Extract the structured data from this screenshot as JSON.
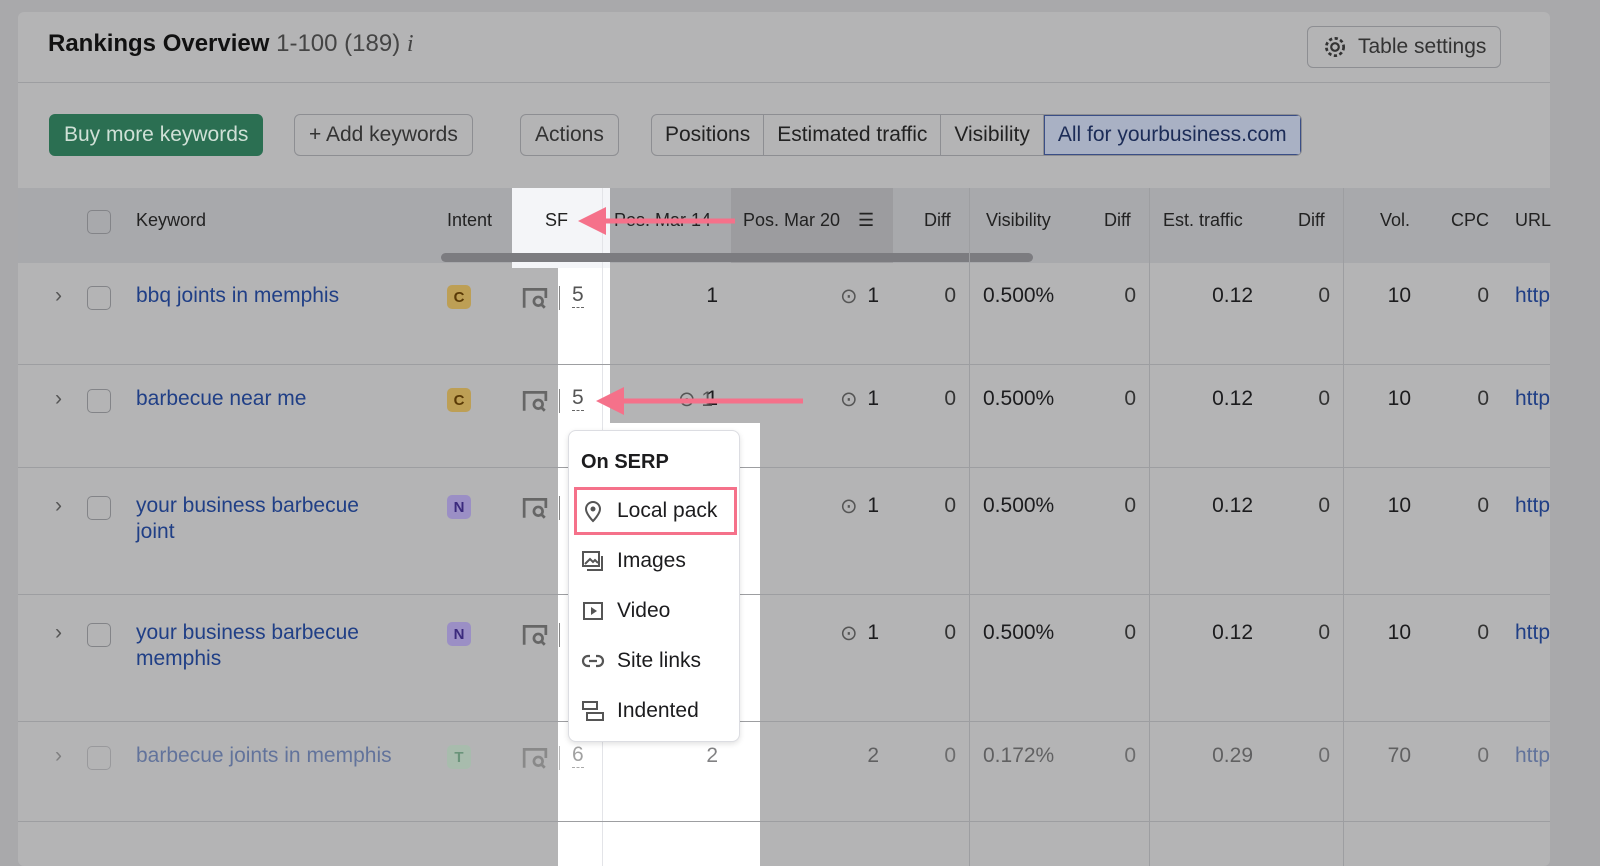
{
  "header": {
    "title": "Rankings Overview",
    "range": "1-100 (189)",
    "info_icon": "info-icon",
    "table_settings": "Table settings"
  },
  "toolbar": {
    "buy": "Buy more keywords",
    "add": "+ Add keywords",
    "actions": "Actions",
    "tabs": [
      {
        "label": "Positions"
      },
      {
        "label": "Estimated traffic"
      },
      {
        "label": "Visibility"
      },
      {
        "label": "All for yourbusiness.com",
        "active": true
      }
    ]
  },
  "columns": [
    "Keyword",
    "Intent",
    "SF",
    "Pos. Mar 14",
    "Pos. Mar 20",
    "Diff",
    "Visibility",
    "Diff",
    "Est. traffic",
    "Diff",
    "Vol.",
    "CPC",
    "URL"
  ],
  "rows": [
    {
      "keyword": "bbq joints in memphis",
      "intent": "C",
      "sf": "5",
      "pos14": "1",
      "pos20": "1",
      "diff": "0",
      "visibility": "0.500%",
      "vdiff": "0",
      "traffic": "0.12",
      "tdiff": "0",
      "vol": "10",
      "cpc": "0",
      "url": "http"
    },
    {
      "keyword": "barbecue near me",
      "intent": "C",
      "sf": "5",
      "pos14": "1",
      "pos20": "1",
      "diff": "0",
      "visibility": "0.500%",
      "vdiff": "0",
      "traffic": "0.12",
      "tdiff": "0",
      "vol": "10",
      "cpc": "0",
      "url": "http"
    },
    {
      "keyword": "your business barbecue joint",
      "intent": "N",
      "sf": "",
      "pos14": "",
      "pos20": "1",
      "diff": "0",
      "visibility": "0.500%",
      "vdiff": "0",
      "traffic": "0.12",
      "tdiff": "0",
      "vol": "10",
      "cpc": "0",
      "url": "http"
    },
    {
      "keyword": "your business barbecue memphis",
      "intent": "N",
      "sf": "",
      "pos14": "",
      "pos20": "1",
      "diff": "0",
      "visibility": "0.500%",
      "vdiff": "0",
      "traffic": "0.12",
      "tdiff": "0",
      "vol": "10",
      "cpc": "0",
      "url": "http"
    },
    {
      "keyword": "barbecue joints in memphis",
      "intent": "T",
      "sf": "6",
      "pos14": "2",
      "pos20": "2",
      "diff": "0",
      "visibility": "0.172%",
      "vdiff": "0",
      "traffic": "0.29",
      "tdiff": "0",
      "vol": "70",
      "cpc": "0",
      "url": "http"
    }
  ],
  "popup": {
    "title": "On SERP",
    "items": [
      {
        "label": "Local pack",
        "icon": "map-pin-icon"
      },
      {
        "label": "Images",
        "icon": "images-icon"
      },
      {
        "label": "Video",
        "icon": "video-icon"
      },
      {
        "label": "Site links",
        "icon": "link-icon"
      },
      {
        "label": "Indented",
        "icon": "indented-icon"
      }
    ]
  },
  "colors": {
    "accent": "#1f6f4f",
    "highlight": "#f5718a",
    "link": "#203f86"
  }
}
